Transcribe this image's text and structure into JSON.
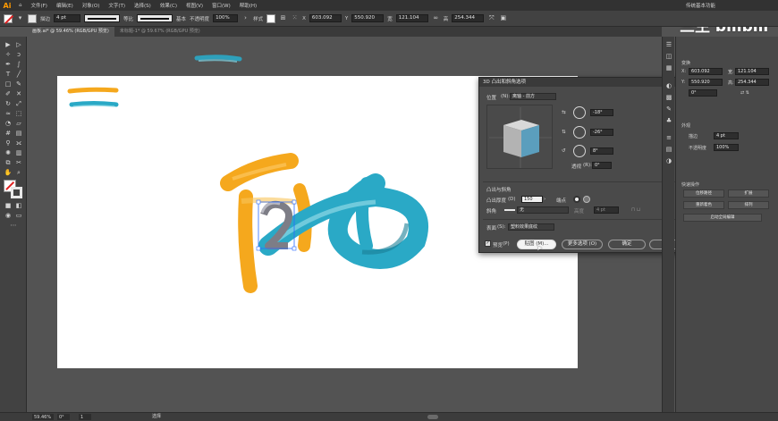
{
  "app": {
    "logo": "Ai",
    "menu": [
      "文件(F)",
      "编辑(E)",
      "对象(O)",
      "文字(T)",
      "选择(S)",
      "效果(C)",
      "视图(V)",
      "窗口(W)",
      "帮助(H)"
    ],
    "workspace": "传统基本功能"
  },
  "control_bar": {
    "stroke_label": "描边",
    "stroke_value": "4 pt",
    "profile_label": "等比",
    "brush_label": "基本",
    "opacity_label": "不透明度",
    "opacity_value": "100%",
    "style_label": "样式",
    "x_label": "X",
    "x_value": "603.092",
    "y_label": "Y",
    "y_value": "550.920",
    "w_label": "宽",
    "w_value": "121.104",
    "h_label": "高",
    "h_value": "254.344"
  },
  "tabs": [
    {
      "label": "画板.ai* @ 59.46% (RGB/GPU 预览)",
      "active": true
    },
    {
      "label": "未标题-1* @ 59.67% (RGB/GPU 预览)",
      "active": false
    }
  ],
  "dialog": {
    "title": "3D 凸出和斜角选项",
    "position_label": "位置",
    "position_key": "(N):",
    "position_value": "离轴 - 前方",
    "rot_x": "-18°",
    "rot_y": "-26°",
    "rot_z": "8°",
    "perspective_label": "透视",
    "perspective_key": "(R):",
    "perspective_value": "0°",
    "extrude_section": "凸出与斜角",
    "extrude_depth_label": "凸出厚度",
    "extrude_depth_key": "(D)",
    "extrude_depth_value": "150",
    "cap_label": "端点",
    "bevel_label": "斜角",
    "bevel_value": "无",
    "height_label": "高度",
    "height_value": "4 pt",
    "surface_label": "表面",
    "surface_key": "(S):",
    "surface_value": "塑料效果底纹",
    "preview_label": "预览",
    "preview_key": "(P)",
    "map_button": "贴图 (M)...",
    "more_button": "更多选项 (O)",
    "ok_button": "确定",
    "cancel_button": "取消"
  },
  "panel": {
    "transform_title": "变换",
    "x_label": "X:",
    "x_value": "603.092",
    "y_label": "Y:",
    "y_value": "550.920",
    "w_label": "宽:",
    "w_value": "121.104",
    "h_label": "高:",
    "h_value": "254.344",
    "angle_value": "0°",
    "appearance_title": "外观",
    "stroke_label": "描边",
    "stroke_value": "4 pt",
    "opacity_label": "不透明度",
    "opacity_value": "100%",
    "quick_actions_title": "快速操作",
    "btn_offset": "位移路径",
    "btn_expand": "扩展",
    "btn_recolor": "重新着色",
    "btn_arrange": "排列",
    "btn_recolor_art": "启动全局编辑"
  },
  "status": {
    "zoom": "59.46%",
    "angle": "0°",
    "artboard_no": "1",
    "tool": "选择"
  },
  "watermark": "三生 bilibili",
  "colors": {
    "orange": "#f5a81d",
    "teal": "#2aa9c6",
    "dialog_bg": "#4a4a4a",
    "cube_front": "#5b9ebd"
  }
}
